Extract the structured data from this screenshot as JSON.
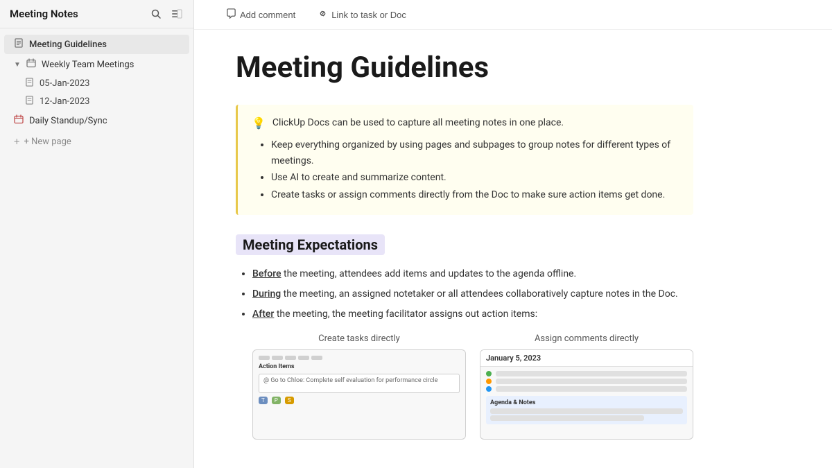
{
  "sidebar": {
    "title": "Meeting Notes",
    "items": [
      {
        "id": "meeting-guidelines",
        "label": "Meeting Guidelines",
        "icon": "📄",
        "active": true,
        "type": "page"
      },
      {
        "id": "weekly-team-meetings",
        "label": "Weekly Team Meetings",
        "icon": "📅",
        "type": "group",
        "expanded": true,
        "children": [
          {
            "id": "05-jan-2023",
            "label": "05-Jan-2023",
            "icon": "📄"
          },
          {
            "id": "12-jan-2023",
            "label": "12-Jan-2023",
            "icon": "📄"
          }
        ]
      },
      {
        "id": "daily-standup",
        "label": "Daily Standup/Sync",
        "icon": "📅",
        "type": "page"
      }
    ],
    "new_page_label": "+ New page"
  },
  "toolbar": {
    "add_comment_label": "Add comment",
    "link_task_label": "Link to task or Doc",
    "comment_icon": "💬",
    "link_icon": "🔗"
  },
  "doc": {
    "title": "Meeting Guidelines",
    "callout": {
      "emoji": "💡",
      "text": "ClickUp Docs can be used to capture all meeting notes in one place.",
      "bullet_items": [
        "Keep everything organized by using pages and subpages to group notes for different types of meetings.",
        "Use AI to create and summarize content.",
        "Create tasks or assign comments directly from the Doc to make sure action items get done."
      ]
    },
    "section_heading": "Meeting Expectations",
    "expectations": [
      {
        "prefix": "Before",
        "rest": " the meeting, attendees add items and updates to the agenda offline."
      },
      {
        "prefix": "During",
        "rest": " the meeting, an assigned notetaker or all attendees collaboratively capture notes in the Doc."
      },
      {
        "prefix": "After",
        "rest": " the meeting, the meeting facilitator assigns out action items:"
      }
    ],
    "image_left_label": "Create tasks directly",
    "image_right_label": "Assign comments directly",
    "image_right_date": "January 5, 2023"
  }
}
